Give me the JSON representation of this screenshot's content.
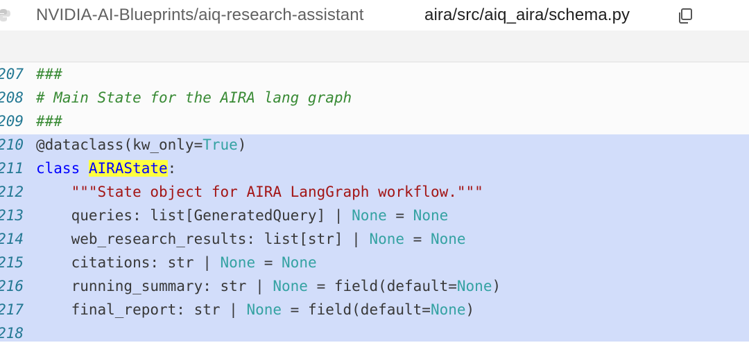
{
  "header": {
    "repo": "NVIDIA-AI-Blueprints/aiq-research-assistant",
    "path": "aira/src/aiq_aira/schema.py"
  },
  "code": {
    "lines": [
      {
        "num": "207",
        "parts": [
          {
            "t": "###",
            "c": "cmt"
          }
        ]
      },
      {
        "num": "208",
        "parts": [
          {
            "t": "# Main State for the AIRA lang graph",
            "c": "cmt"
          }
        ]
      },
      {
        "num": "209",
        "parts": [
          {
            "t": "###",
            "c": "cmt"
          }
        ]
      },
      {
        "num": "210",
        "parts": [
          {
            "t": "@dataclass(kw_only=",
            "c": ""
          },
          {
            "t": "True",
            "c": "bi"
          },
          {
            "t": ")",
            "c": ""
          }
        ]
      },
      {
        "num": "211",
        "parts": [
          {
            "t": "class ",
            "c": "kw"
          },
          {
            "t": "AIRAState",
            "c": "hl"
          },
          {
            "t": ":",
            "c": ""
          }
        ]
      },
      {
        "num": "212",
        "parts": [
          {
            "t": "    ",
            "c": ""
          },
          {
            "t": "\"\"\"State object for AIRA LangGraph workflow.\"\"\"",
            "c": "str"
          }
        ]
      },
      {
        "num": "213",
        "parts": [
          {
            "t": "    queries: list[GeneratedQuery] | ",
            "c": ""
          },
          {
            "t": "None",
            "c": "bi"
          },
          {
            "t": " = ",
            "c": ""
          },
          {
            "t": "None",
            "c": "bi"
          }
        ]
      },
      {
        "num": "214",
        "parts": [
          {
            "t": "    web_research_results: list[str] | ",
            "c": ""
          },
          {
            "t": "None",
            "c": "bi"
          },
          {
            "t": " = ",
            "c": ""
          },
          {
            "t": "None",
            "c": "bi"
          }
        ]
      },
      {
        "num": "215",
        "parts": [
          {
            "t": "    citations: str | ",
            "c": ""
          },
          {
            "t": "None",
            "c": "bi"
          },
          {
            "t": " = ",
            "c": ""
          },
          {
            "t": "None",
            "c": "bi"
          }
        ]
      },
      {
        "num": "216",
        "parts": [
          {
            "t": "    running_summary: str | ",
            "c": ""
          },
          {
            "t": "None",
            "c": "bi"
          },
          {
            "t": " = field(default=",
            "c": ""
          },
          {
            "t": "None",
            "c": "bi"
          },
          {
            "t": ")",
            "c": ""
          }
        ]
      },
      {
        "num": "217",
        "parts": [
          {
            "t": "    final_report: str | ",
            "c": ""
          },
          {
            "t": "None",
            "c": "bi"
          },
          {
            "t": " = field(default=",
            "c": ""
          },
          {
            "t": "None",
            "c": "bi"
          },
          {
            "t": ")",
            "c": ""
          }
        ]
      },
      {
        "num": "218",
        "parts": []
      }
    ]
  },
  "colors": {
    "selection": "#d2ddfa",
    "highlight": "#ffff40",
    "comment": "#388a34",
    "keyword": "#0000ff",
    "builtin": "#34a2a2",
    "string": "#a31515",
    "line_number": "#237893"
  },
  "icons": {
    "repo": "python-icon",
    "copy": "copy-icon"
  }
}
